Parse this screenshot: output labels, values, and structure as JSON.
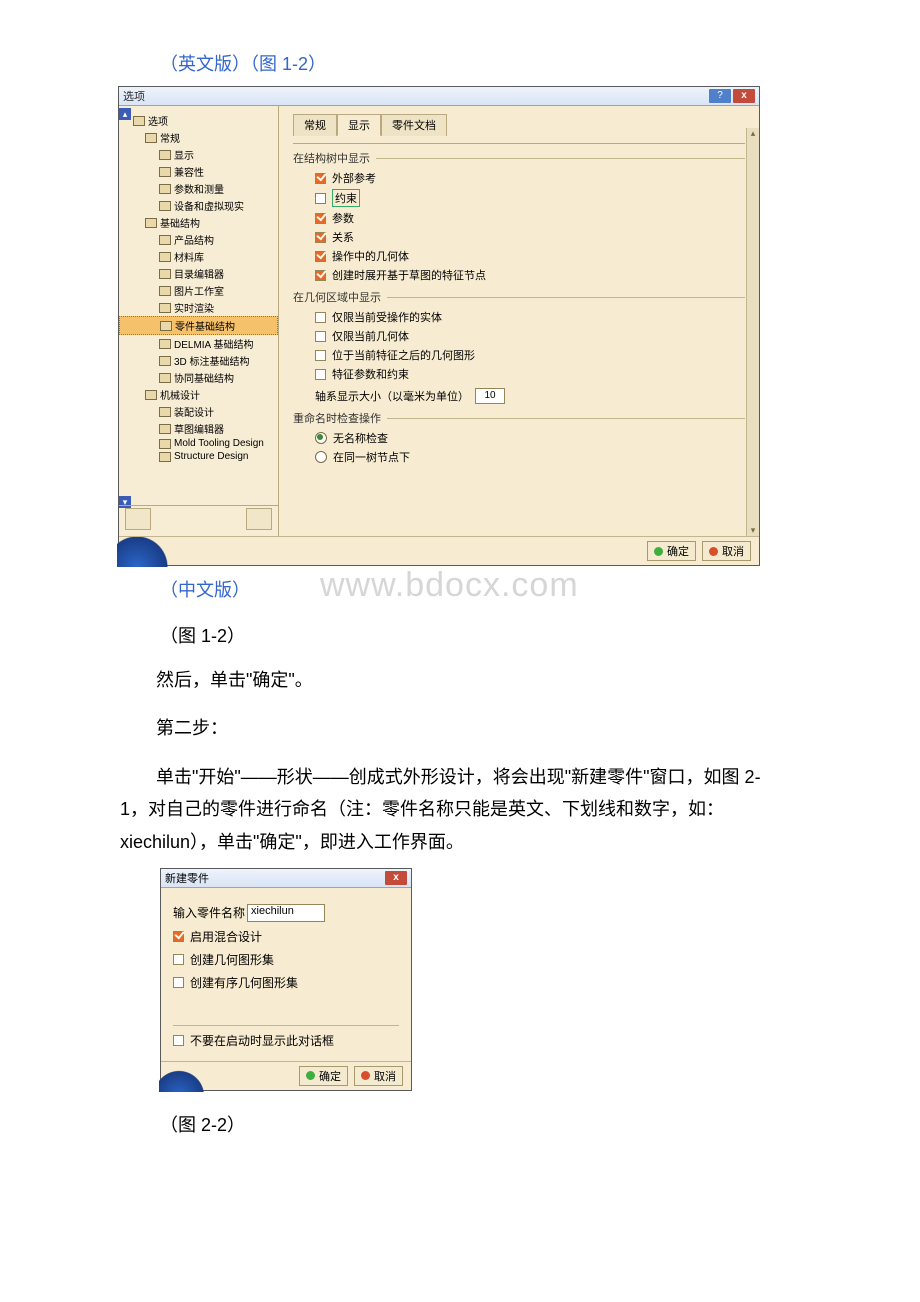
{
  "captions": {
    "eng_version": "（英文版）（图 1-2）",
    "chn_version": "（中文版）",
    "fig12": "（图 1-2）",
    "fig22": "（图 2-2）"
  },
  "watermark": "www.bdocx.com",
  "paragraphs": {
    "p1": "然后，单击\"确定\"。",
    "p2": "第二步：",
    "p3": "单击\"开始\"——形状——创成式外形设计，将会出现\"新建零件\"窗口，如图 2-1，对自己的零件进行命名（注：零件名称只能是英文、下划线和数字，如：xiechilun），单击\"确定\"，即进入工作界面。"
  },
  "dlg1": {
    "title": "选项",
    "help": "?",
    "close": "x",
    "tree": {
      "n0": "选项",
      "n1": "常规",
      "n2": "显示",
      "n3": "兼容性",
      "n4": "参数和测量",
      "n5": "设备和虚拟现实",
      "n6": "基础结构",
      "n7": "产品结构",
      "n8": "材料库",
      "n9": "目录编辑器",
      "n10": "图片工作室",
      "n11": "实时渲染",
      "n12": "零件基础结构",
      "n13": "DELMIA 基础结构",
      "n14": "3D 标注基础结构",
      "n15": "协同基础结构",
      "n16": "机械设计",
      "n17": "装配设计",
      "n18": "草图编辑器",
      "n19": "Mold Tooling Design",
      "n20": "Structure Design"
    },
    "tabs": {
      "t1": "常规",
      "t2": "显示",
      "t3": "零件文档"
    },
    "grp1": "在结构树中显示",
    "opts1": {
      "o1": "外部参考",
      "o2": "约束",
      "o3": "参数",
      "o4": "关系",
      "o5": "操作中的几何体",
      "o6": "创建时展开基于草图的特征节点"
    },
    "grp2": "在几何区域中显示",
    "opts2": {
      "o1": "仅限当前受操作的实体",
      "o2": "仅限当前几何体",
      "o3": "位于当前特征之后的几何图形",
      "o4": "特征参数和约束"
    },
    "axisLine": "轴系显示大小（以毫米为单位）",
    "axisVal": "10",
    "grp3": "重命名时检查操作",
    "radio1": "无名称检查",
    "radio2": "在同一树节点下",
    "ok": "确定",
    "cancel": "取消"
  },
  "dlg2": {
    "title": "新建零件",
    "close": "x",
    "label1": "输入零件名称",
    "input": "xiechilun",
    "c1": "启用混合设计",
    "c2": "创建几何图形集",
    "c3": "创建有序几何图形集",
    "c4": "不要在启动时显示此对话框",
    "ok": "确定",
    "cancel": "取消"
  }
}
